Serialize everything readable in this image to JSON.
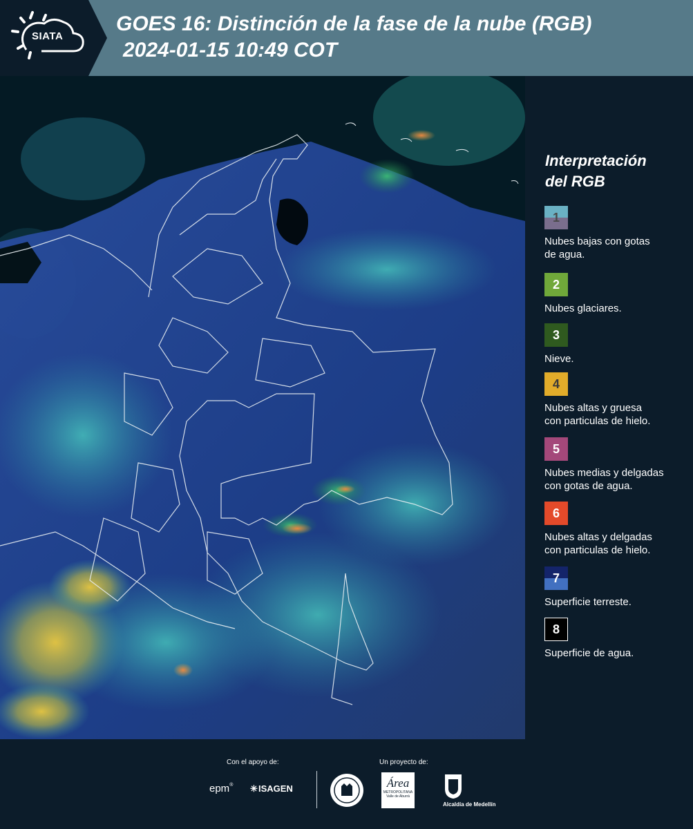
{
  "header": {
    "logo_text": "SIATA",
    "title_line1": "GOES 16: Distinción de la fase de la nube (RGB)",
    "title_line2": "2024-01-15 10:49 COT"
  },
  "legend": {
    "title_line1": "Interpretación",
    "title_line2": "del RGB",
    "items": [
      {
        "number": "1",
        "label_line1": "Nubes bajas con gotas",
        "label_line2": "de agua.",
        "color_top": "#6ab1c4",
        "color_bottom": "#7a6e8d",
        "num_color": "#4a4a4a"
      },
      {
        "number": "2",
        "label_line1": "Nubes glaciares.",
        "label_line2": "",
        "color_top": "#70a83a",
        "color_bottom": "#70a83a",
        "num_color": "#ffffff"
      },
      {
        "number": "3",
        "label_line1": "Nieve.",
        "label_line2": "",
        "color_top": "#2f5a1f",
        "color_bottom": "#2f5a1f",
        "num_color": "#ffffff"
      },
      {
        "number": "4",
        "label_line1": "Nubes altas y gruesa",
        "label_line2": "con particulas de hielo.",
        "color_top": "#e2ac2a",
        "color_bottom": "#e2ac2a",
        "num_color": "#3a3a3a"
      },
      {
        "number": "5",
        "label_line1": "Nubes medias y delgadas",
        "label_line2": "con gotas de agua.",
        "color_top": "#a4487a",
        "color_bottom": "#a4487a",
        "num_color": "#ffffff"
      },
      {
        "number": "6",
        "label_line1": "Nubes altas y delgadas",
        "label_line2": "con particulas de hielo.",
        "color_top": "#e44a2a",
        "color_bottom": "#e44a2a",
        "num_color": "#ffffff"
      },
      {
        "number": "7",
        "label_line1": "Superficie terreste.",
        "label_line2": "",
        "color_top": "#14246a",
        "color_bottom": "#4270c0",
        "num_color": "#ffffff"
      },
      {
        "number": "8",
        "label_line1": "Superficie de agua.",
        "label_line2": "",
        "color_top": "#000000",
        "color_bottom": "#000000",
        "num_color": "#ffffff"
      }
    ]
  },
  "footer": {
    "support_caption": "Con el apoyo de:",
    "project_caption": "Un proyecto de:",
    "sponsor_epm": "epm",
    "sponsor_isagen": "ISAGEN",
    "area_word": "Área",
    "area_small1": "METROPOLITANA",
    "area_small2": "Valle de Aburrá",
    "alcaldia": "Alcaldía de Medellín"
  },
  "colors": {
    "header_bg": "#567a89",
    "logo_tab_bg": "#0c1c2a",
    "panel_bg": "#0c1c2a"
  }
}
